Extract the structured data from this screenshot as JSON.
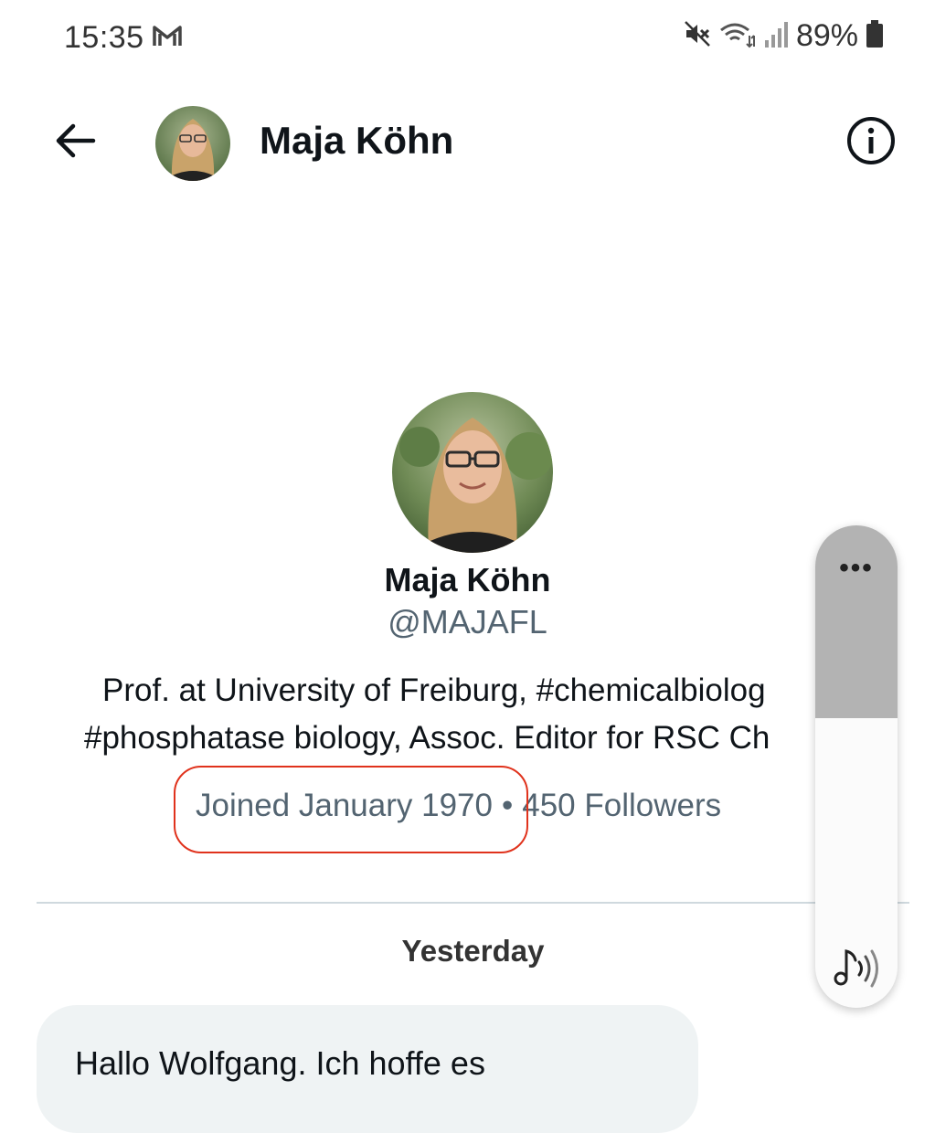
{
  "status_bar": {
    "time": "15:35",
    "battery": "89%",
    "icons": [
      "gmail-icon",
      "mute-icon",
      "wifi-icon",
      "signal-icon",
      "battery-icon"
    ]
  },
  "header": {
    "name": "Maja Köhn",
    "back_icon": "arrow-left-icon",
    "info_icon": "info-icon"
  },
  "profile": {
    "name": "Maja Köhn",
    "handle": "@MAJAFL",
    "bio_line1": "Prof. at University of Freiburg, #chemicalbiolog",
    "bio_line2": "#phosphatase biology, Assoc. Editor for RSC Ch",
    "joined": "Joined January 1970",
    "separator": "•",
    "followers": "450 Followers"
  },
  "conversation": {
    "date_label": "Yesterday",
    "message": "Hallo Wolfgang. Ich hoffe es"
  },
  "volume_panel": {
    "more": "•••",
    "level": 0.4,
    "icon": "music-note-sound-icon"
  },
  "colors": {
    "text_primary": "#0f1419",
    "text_secondary": "#536471",
    "highlight": "#e0321c",
    "bubble_bg": "#eff3f4"
  }
}
